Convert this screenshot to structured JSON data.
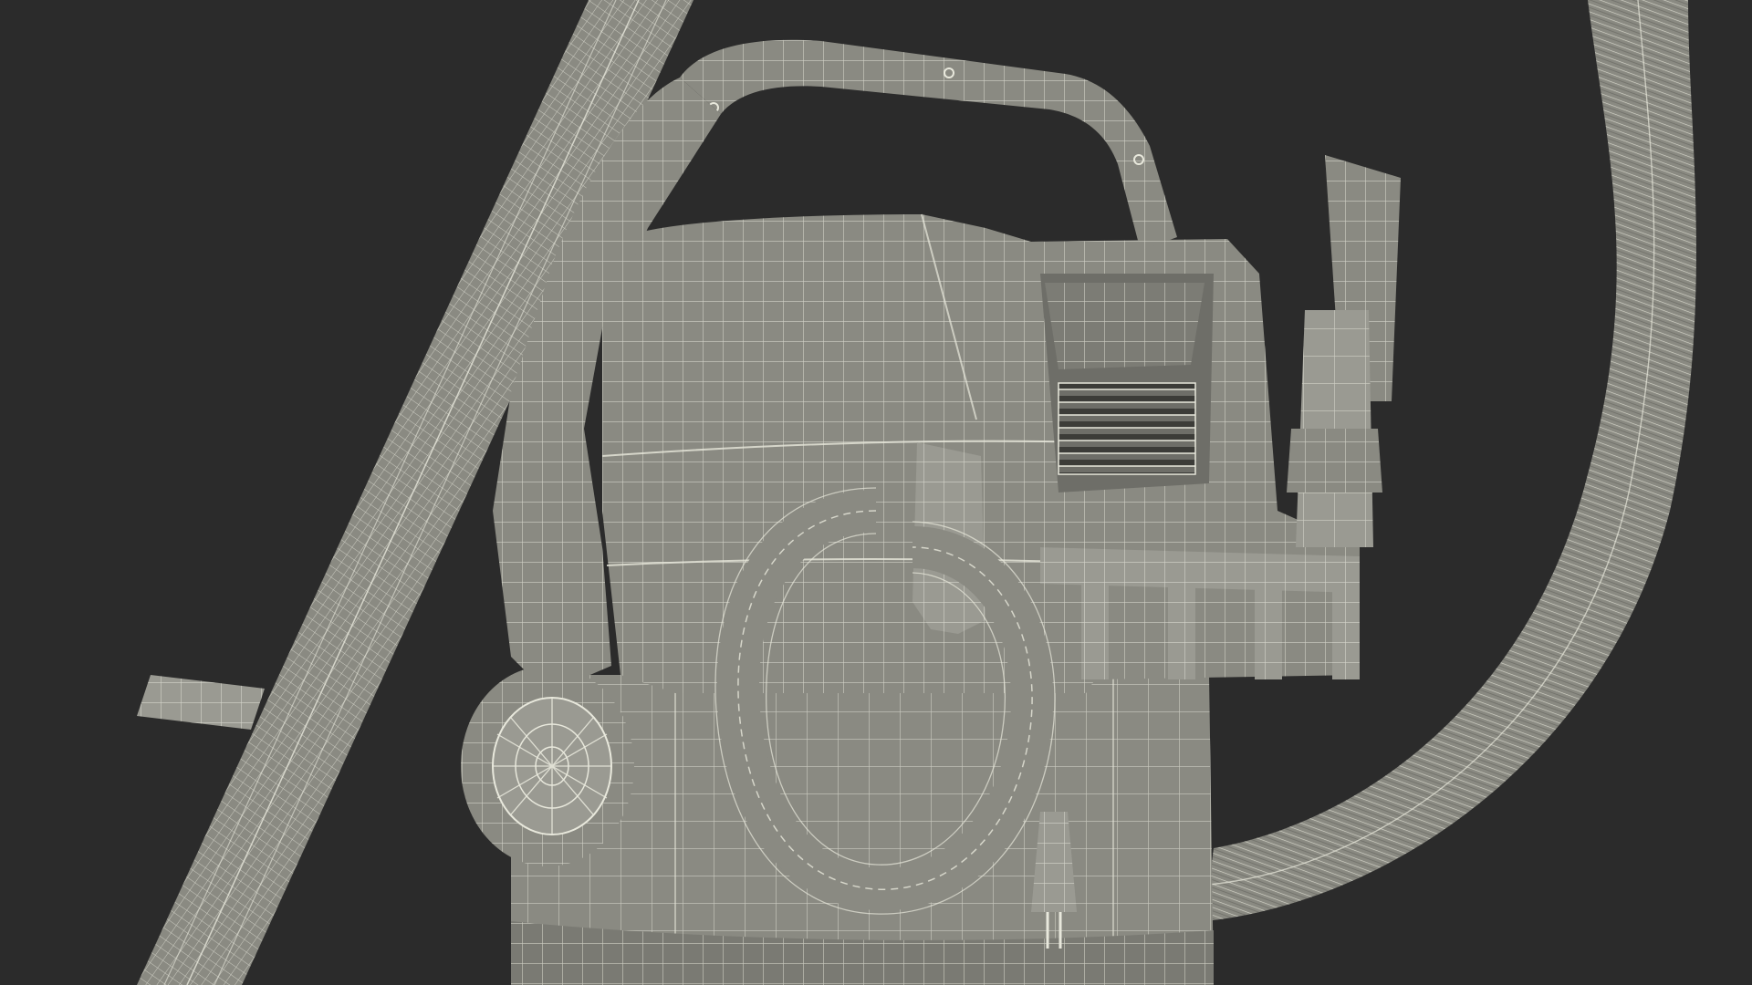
{
  "scene": {
    "subject": "wireframe-render",
    "colors": {
      "background": "#2b2b2b",
      "surface": "#8a8a82",
      "surface_light": "#9a9a92",
      "surface_dark": "#6e6e68",
      "wire": "#e8e8dc",
      "shadow": "#55554f"
    }
  }
}
